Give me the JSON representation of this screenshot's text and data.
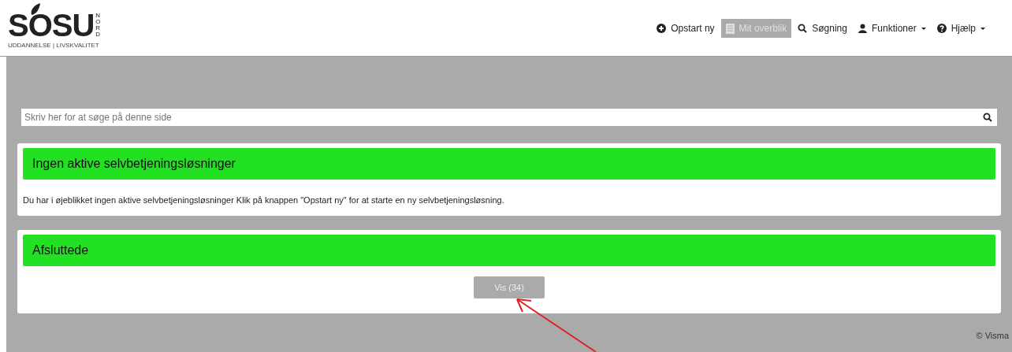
{
  "logo": {
    "name": "SOSU",
    "side": "NORD",
    "tagline": "UDDANNELSE | LIVSKVALITET"
  },
  "nav": [
    {
      "label": "Opstart ny",
      "selected": false,
      "dropdown": false
    },
    {
      "label": "Mit overblik",
      "selected": true,
      "dropdown": false
    },
    {
      "label": "Søgning",
      "selected": false,
      "dropdown": false
    },
    {
      "label": "Funktioner",
      "selected": false,
      "dropdown": true
    },
    {
      "label": "Hjælp",
      "selected": false,
      "dropdown": true
    }
  ],
  "search": {
    "placeholder": "Skriv her for at søge på denne side"
  },
  "panels": [
    {
      "title": "Ingen aktive selvbetjeningsløsninger",
      "text": "Du har i øjeblikket ingen aktive selvbetjeningsløsninger Klik på knappen \"Opstart ny\" for at starte en ny selvbetjeningsløsning."
    },
    {
      "title": "Afsluttede",
      "button": "Vis (34)"
    }
  ],
  "footer": "© Visma"
}
